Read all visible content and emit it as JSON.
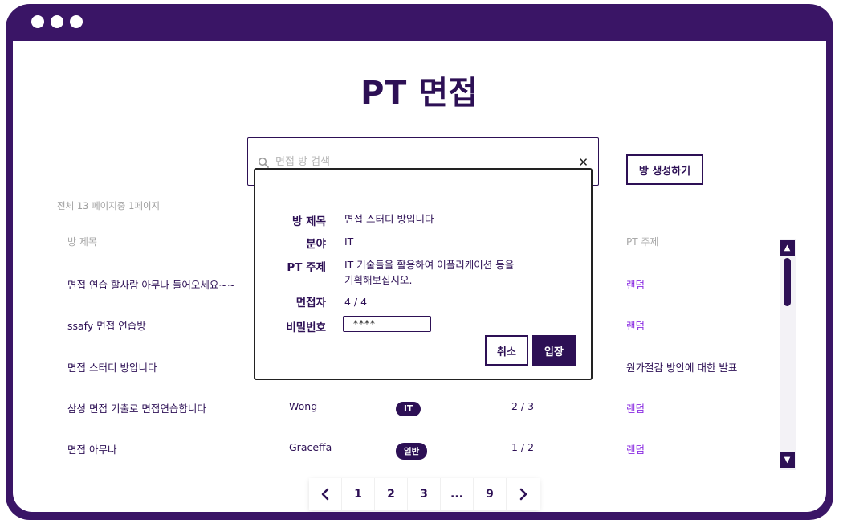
{
  "page": {
    "title": "PT 면접",
    "page_info": "전체 13 페이지중 1페이지",
    "create_button": "방 생성하기"
  },
  "search": {
    "placeholder": "면접 방 검색",
    "value": ""
  },
  "table": {
    "headers": {
      "title": "방 제목",
      "topic": "PT 주제"
    },
    "rows": [
      {
        "title": "면접 연습 할사람 아무나 들어오세요~~",
        "host": "",
        "field": "",
        "count": "",
        "topic": "랜덤"
      },
      {
        "title": "ssafy 면접 연습방",
        "host": "",
        "field": "",
        "count": "",
        "topic": "랜덤"
      },
      {
        "title": "면접 스터디 방입니다",
        "host": "",
        "field": "",
        "count": "",
        "topic": "원가절감 방안에 대한 발표"
      },
      {
        "title": "삼성 면접 기출로 면접연습합니다",
        "host": "Wong",
        "field": "IT",
        "count": "2 / 3",
        "topic": "랜덤"
      },
      {
        "title": "면접 아무나",
        "host": "Graceffa",
        "field": "일반",
        "count": "1 / 2",
        "topic": "랜덤"
      }
    ]
  },
  "pagination": {
    "pages": [
      "1",
      "2",
      "3",
      "...",
      "9"
    ]
  },
  "modal": {
    "labels": {
      "title": "방 제목",
      "field": "분야",
      "topic": "PT 주제",
      "participants": "면접자",
      "password": "비밀번호"
    },
    "values": {
      "title": "면접 스터디 방입니다",
      "field": "IT",
      "topic_line1": "IT 기술들을 활용하여 어플리케이션 등을",
      "topic_line2": "기획해보십시오.",
      "participants": "4 / 4",
      "password": "****"
    },
    "cancel_button": "취소",
    "enter_button": "입장"
  },
  "colors": {
    "primary": "#2d1055",
    "frame": "#3a1566",
    "accent": "#8a2be2"
  }
}
